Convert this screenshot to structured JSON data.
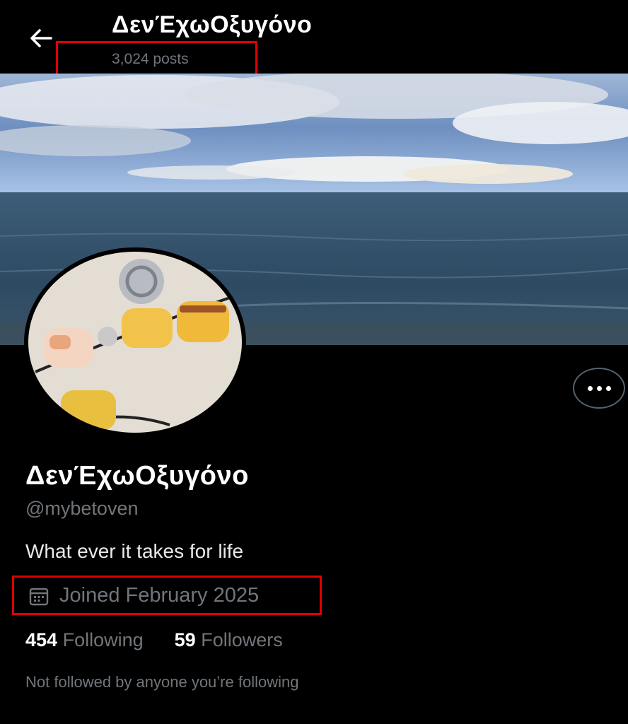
{
  "header": {
    "display_name": "ΔενΈχωΟξυγόνο",
    "post_count": "3,024 posts",
    "back_icon": "arrow-left-icon"
  },
  "profile": {
    "display_name": "ΔενΈχωΟξυγόνο",
    "handle": "@mybetoven",
    "bio": "What ever it takes for life",
    "joined": "Joined February 2025",
    "joined_icon": "calendar-icon",
    "following_count": "454",
    "following_label": "Following",
    "followers_count": "59",
    "followers_label": "Followers",
    "mutuals_note": "Not followed by anyone you’re following"
  },
  "more_icon": "more-options-icon",
  "colors": {
    "background": "#000000",
    "text": "#e7e9ea",
    "muted": "#71767b",
    "highlight": "#e00000"
  }
}
